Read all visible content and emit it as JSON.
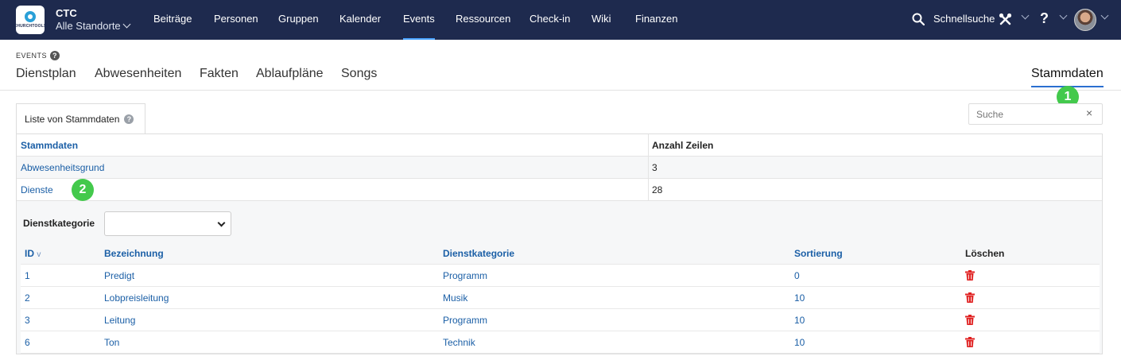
{
  "app": {
    "org_name": "CTC",
    "location": "Alle Standorte",
    "logo_text": "CHURCHTOOLS",
    "nav": [
      "Beiträge",
      "Personen",
      "Gruppen",
      "Kalender",
      "Events",
      "Ressourcen",
      "Check-in",
      "Wiki",
      "Finanzen"
    ],
    "active_nav": "Events",
    "search_label": "Schnellsuche",
    "help_label": "?"
  },
  "module": {
    "label": "EVENTS",
    "help_icon": "?",
    "tabs": [
      "Dienstplan",
      "Abwesenheiten",
      "Fakten",
      "Ablaufpläne",
      "Songs"
    ],
    "right_tab": "Stammdaten",
    "badges": [
      "1",
      "2"
    ]
  },
  "panel": {
    "tab_label": "Liste von Stammdaten",
    "search_placeholder": "Suche",
    "clear_icon": "×"
  },
  "master": {
    "headers": [
      "Stammdaten",
      "Anzahl Zeilen"
    ],
    "rows": [
      {
        "name": "Abwesenheitsgrund",
        "count": "3"
      },
      {
        "name": "Dienste",
        "count": "28"
      }
    ]
  },
  "detail": {
    "filter_label": "Dienstkategorie",
    "filter_value": "",
    "headers": [
      "ID",
      "Bezeichnung",
      "Dienstkategorie",
      "Sortierung",
      "Löschen"
    ],
    "sort_indicator": "v",
    "rows": [
      {
        "id": "1",
        "name": "Predigt",
        "category": "Programm",
        "sort": "0"
      },
      {
        "id": "2",
        "name": "Lobpreisleitung",
        "category": "Musik",
        "sort": "10"
      },
      {
        "id": "3",
        "name": "Leitung",
        "category": "Programm",
        "sort": "10"
      },
      {
        "id": "6",
        "name": "Ton",
        "category": "Technik",
        "sort": "10"
      }
    ]
  },
  "colors": {
    "topbar": "#1e2a4e",
    "link": "#1b5fa6",
    "badge": "#43c94c",
    "delete": "#e02020"
  }
}
